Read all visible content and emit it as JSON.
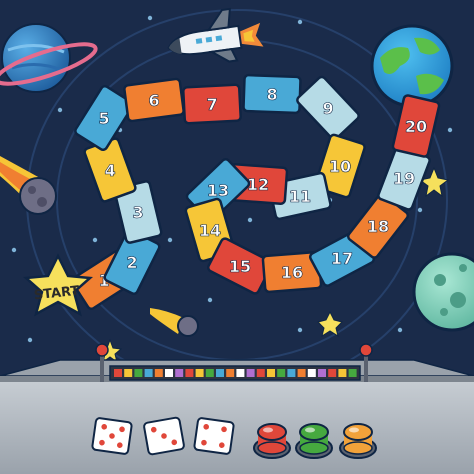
{
  "scene": {
    "background": "#1a2b4a",
    "orbit_ring_color": "#26406a",
    "console_color": "#b9c0c8",
    "console_dark": "#8e969f"
  },
  "start_label": "START",
  "palette": [
    "#49a9d6",
    "#f07f31",
    "#f6c637",
    "#b6dbe6",
    "#e0473a"
  ],
  "board_path": {
    "tiles": [
      {
        "number": "1",
        "color": "#f07f31"
      },
      {
        "number": "2",
        "color": "#49a9d6"
      },
      {
        "number": "3",
        "color": "#b6dbe6"
      },
      {
        "number": "4",
        "color": "#f6c637"
      },
      {
        "number": "5",
        "color": "#49a9d6"
      },
      {
        "number": "6",
        "color": "#f07f31"
      },
      {
        "number": "7",
        "color": "#e0473a"
      },
      {
        "number": "8",
        "color": "#49a9d6"
      },
      {
        "number": "9",
        "color": "#b6dbe6"
      },
      {
        "number": "10",
        "color": "#f6c637"
      },
      {
        "number": "11",
        "color": "#b6dbe6"
      },
      {
        "number": "12",
        "color": "#e0473a"
      },
      {
        "number": "13",
        "color": "#49a9d6"
      },
      {
        "number": "14",
        "color": "#f6c637"
      },
      {
        "number": "15",
        "color": "#e0473a"
      },
      {
        "number": "16",
        "color": "#f07f31"
      },
      {
        "number": "17",
        "color": "#49a9d6"
      },
      {
        "number": "18",
        "color": "#f07f31"
      },
      {
        "number": "19",
        "color": "#b6dbe6"
      },
      {
        "number": "20",
        "color": "#e0473a"
      }
    ]
  },
  "dice": [
    {
      "name": "die-1",
      "pips": 5
    },
    {
      "name": "die-2",
      "pips": 3
    },
    {
      "name": "die-3",
      "pips": 4
    }
  ],
  "buttons": [
    {
      "name": "red-button",
      "color": "#e0473a"
    },
    {
      "name": "green-button",
      "color": "#46a93f"
    },
    {
      "name": "orange-button",
      "color": "#f2a23a"
    }
  ],
  "panel_light_colors": [
    "#e0473a",
    "#f6c637",
    "#46a93f",
    "#49a9d6",
    "#f07f31",
    "#ffffff",
    "#b06fd0"
  ]
}
